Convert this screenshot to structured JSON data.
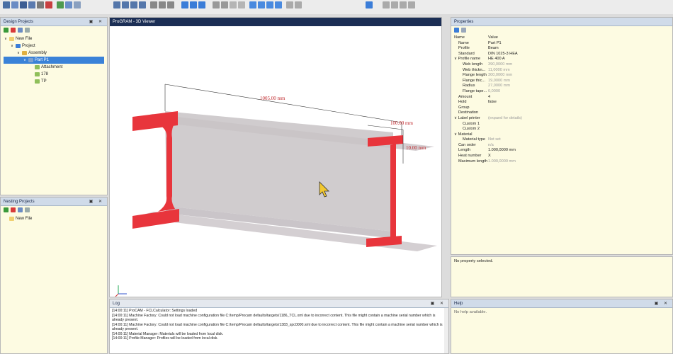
{
  "design_projects": {
    "title": "Design Projects",
    "tree": [
      {
        "label": "New File",
        "level": 0,
        "expanded": true
      },
      {
        "label": "Project",
        "level": 1,
        "expanded": true
      },
      {
        "label": "Assembly",
        "level": 2,
        "expanded": true
      },
      {
        "label": "Part P1",
        "level": 3,
        "expanded": true,
        "selected": true
      },
      {
        "label": "Attachment",
        "level": 4
      },
      {
        "label": "178",
        "level": 4
      },
      {
        "label": "TP",
        "level": 4
      }
    ]
  },
  "nesting_projects": {
    "title": "Nesting Projects",
    "tree": [
      {
        "label": "New File",
        "level": 0
      }
    ]
  },
  "viewer": {
    "title": "ProGRAM - 3D Viewer",
    "dim_length": "1005.00 mm",
    "dim_width": "100.00 mm",
    "dim_thickness": "10.00 mm"
  },
  "properties": {
    "title": "Properties",
    "header": {
      "name": "Name",
      "value": "Value"
    },
    "rows": [
      {
        "k": "Name",
        "v": "Part P1",
        "indent": 1
      },
      {
        "k": "Profile",
        "v": "Beam",
        "indent": 1
      },
      {
        "k": "Standard",
        "v": "DIN 1025-3 HEA",
        "indent": 1
      },
      {
        "k": "Profile name",
        "v": "HE 400 A",
        "indent": 0,
        "group": true
      },
      {
        "k": "Web length",
        "v": "390,0000 mm",
        "indent": 2,
        "grey": true
      },
      {
        "k": "Web thickn...",
        "v": "11,0000 mm",
        "indent": 2,
        "grey": true
      },
      {
        "k": "Flange length",
        "v": "300,0000 mm",
        "indent": 2,
        "grey": true
      },
      {
        "k": "Flange thic...",
        "v": "19,0000 mm",
        "indent": 2,
        "grey": true
      },
      {
        "k": "Radius",
        "v": "27,0000 mm",
        "indent": 2,
        "grey": true
      },
      {
        "k": "Flange tape...",
        "v": "0,0000",
        "indent": 2,
        "grey": true
      },
      {
        "k": "Amount",
        "v": "4",
        "indent": 1
      },
      {
        "k": "Hold",
        "v": "false",
        "indent": 1
      },
      {
        "k": "Group",
        "v": "",
        "indent": 1
      },
      {
        "k": "Destination",
        "v": "",
        "indent": 1
      },
      {
        "k": "Label printer",
        "v": "(expand for details)",
        "indent": 0,
        "group": true,
        "greyv": true
      },
      {
        "k": "Custom 1",
        "v": "",
        "indent": 2
      },
      {
        "k": "Custom 2",
        "v": "",
        "indent": 2
      },
      {
        "k": "Material",
        "v": "",
        "indent": 0,
        "group": true
      },
      {
        "k": "Material type",
        "v": "Not set",
        "indent": 2,
        "greyv": true
      },
      {
        "k": "Can order",
        "v": "n/a",
        "indent": 1,
        "greyv": true
      },
      {
        "k": "Length",
        "v": "1.000,0000 mm",
        "indent": 1
      },
      {
        "k": "Heat number",
        "v": "X",
        "indent": 1
      },
      {
        "k": "Maximum length",
        "v": "1.000,0000 mm",
        "indent": 1,
        "greyv": true
      }
    ],
    "status": "No property selected."
  },
  "log": {
    "title": "Log",
    "lines": [
      "[14:00:11] ProCAM - FCLCalculator: Settings loaded",
      "[14:00:11] Machine Factory: Could not load machine configuration file C:/temp/Procam defaults/targets/1186_TCL.xml due to incorrect content. This file might contain a machine serial number which is",
      "already present.",
      "[14:00:11] Machine Factory: Could not load machine configuration file C:/temp/Procam defaults/targets/1383_spc0000.xml due to incorrect content. This file might contain a machine serial number which is",
      "already present.",
      "[14:00:11] Material Manager: Materials will be loaded from local disk.",
      "[14:00:11] Profile Manager: Profiles will be loaded from local disk."
    ]
  },
  "help": {
    "title": "Help",
    "text": "No help available."
  },
  "colors": {
    "beam_edge": "#e8353c",
    "beam_body": "#c8c3c6",
    "panel_yellow": "#fdfbe2",
    "selection": "#3a82d8",
    "header": "#d0dbe9"
  }
}
